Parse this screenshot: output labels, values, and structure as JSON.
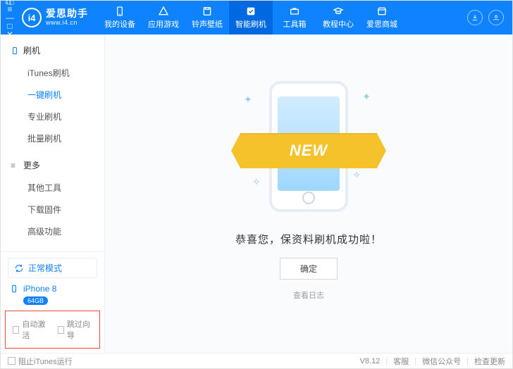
{
  "brand": {
    "logo_text": "i4",
    "cn": "爱思助手",
    "en": "www.i4.cn"
  },
  "nav": {
    "items": [
      {
        "label": "我的设备"
      },
      {
        "label": "应用游戏"
      },
      {
        "label": "铃声壁纸"
      },
      {
        "label": "智能刷机"
      },
      {
        "label": "工具箱"
      },
      {
        "label": "教程中心"
      },
      {
        "label": "爱思商城"
      }
    ],
    "active_index": 3
  },
  "sidebar": {
    "section1": {
      "title": "刷机"
    },
    "items1": [
      {
        "label": "iTunes刷机"
      },
      {
        "label": "一键刷机"
      },
      {
        "label": "专业刷机"
      },
      {
        "label": "批量刷机"
      }
    ],
    "active1_index": 1,
    "section2": {
      "title": "更多"
    },
    "items2": [
      {
        "label": "其他工具"
      },
      {
        "label": "下载固件"
      },
      {
        "label": "高级功能"
      }
    ],
    "device": {
      "mode": "正常模式",
      "model": "iPhone 8",
      "storage": "64GB"
    },
    "checks": {
      "auto_activate": "自动激活",
      "skip_guide": "跳过向导"
    }
  },
  "content": {
    "ribbon": "NEW",
    "result": "恭喜您，保资料刷机成功啦！",
    "ok": "确定",
    "log": "查看日志"
  },
  "statusbar": {
    "block_itunes": "阻止iTunes运行",
    "version": "V8.12",
    "support": "客服",
    "wechat": "微信公众号",
    "update": "检查更新"
  }
}
